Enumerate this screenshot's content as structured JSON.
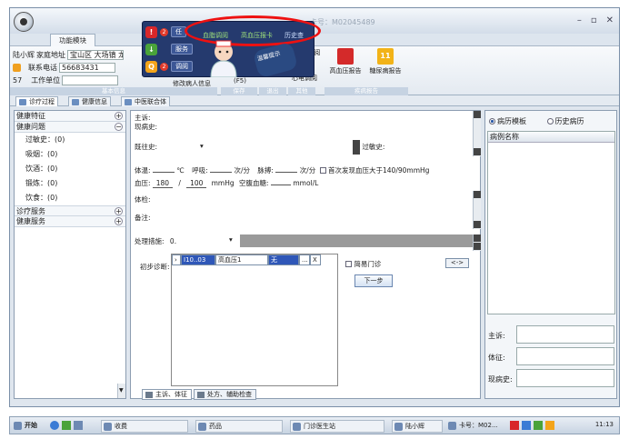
{
  "window": {
    "title_partial": "卡号：M02045489",
    "ribbon_tab": "功能模块"
  },
  "patient": {
    "name": "陆小辉",
    "address_label": "家庭地址",
    "address": "宝山区 大场镇 龙",
    "phone_label": "联系电话",
    "phone": "56683431",
    "age": "57",
    "work_label": "工作单位",
    "group_caption": "基本信息"
  },
  "ribbon": {
    "modify_patient": "修改病人信息",
    "f5": "(F5)",
    "save_caption": "保存",
    "exit_caption": "退出",
    "other_caption": "其他",
    "cs_query": "CS调阅",
    "query": "调阅",
    "ecg_query": "心电调阅",
    "hypertension_report": "高血压报告",
    "diabetes_report": "糖尿病报告",
    "disease_caption": "疾病报告"
  },
  "popup": {
    "warning_btn": "任",
    "badge1": "2",
    "service_btn": "服务",
    "query_btn": "调阅",
    "badge2": "2",
    "link_lipid": "血脂调阅",
    "link_hbp": "高血压报卡",
    "link_more": "历史查",
    "callout_text": "温馨提示"
  },
  "doc_tabs": [
    "诊疗过程",
    "健康信息",
    "中医联合体"
  ],
  "left_panel": {
    "sections": [
      {
        "label": "健康特征"
      },
      {
        "label": "健康问题"
      }
    ],
    "sub_items": [
      "过敏史：(0)",
      "吸烟：(0)",
      "饮酒：(0)",
      "锻炼：(0)",
      "饮食：(0)"
    ],
    "bottom_sections": [
      "诊疗服务",
      "健康服务"
    ]
  },
  "form": {
    "chief_complaint": "主诉:",
    "present_history": "现病史:",
    "past_history": "既往史:",
    "allergy": "过敏史:",
    "temp_label": "体温:",
    "temp_unit": "℃",
    "resp_label": "呼吸:",
    "resp_unit": "次/分",
    "pulse_label": "脉搏:",
    "pulse_unit": "次/分",
    "first_bp_check": "首次发现血压大于140/90mmHg",
    "bp_label": "血压:",
    "bp_sys": "180",
    "bp_sep": "/",
    "bp_dia": "100",
    "bp_unit": "mmHg",
    "glucose_label": "空腹血糖:",
    "glucose_unit": "mmol/L",
    "exam_label": "体检:",
    "note_label": "备注:",
    "treatment_label": "处理措施:",
    "treatment_value": "0.",
    "initial_dx_label": "初步诊断:",
    "dx_code": "I10..03",
    "dx_name": "高血压1",
    "dx_extra": "无",
    "dx_btn_more": "...",
    "dx_btn_x": "X",
    "simple_clinic": "简易门诊",
    "arrow_btn": "<->",
    "next_btn": "下一步"
  },
  "bottom_tabs": [
    "主诉、体征",
    "处方、辅助检查"
  ],
  "right_panel": {
    "radio_template": "病历模板",
    "radio_history": "历史病历",
    "list_header": "病例名称",
    "label_complaint": "主诉:",
    "label_sign": "体征:",
    "label_history": "现病史:"
  },
  "taskbar": {
    "start": "开始",
    "items": [
      "收费",
      "药品",
      "门诊医生站",
      "陆小辉",
      "卡号：M02..."
    ],
    "clock": "11:13"
  }
}
